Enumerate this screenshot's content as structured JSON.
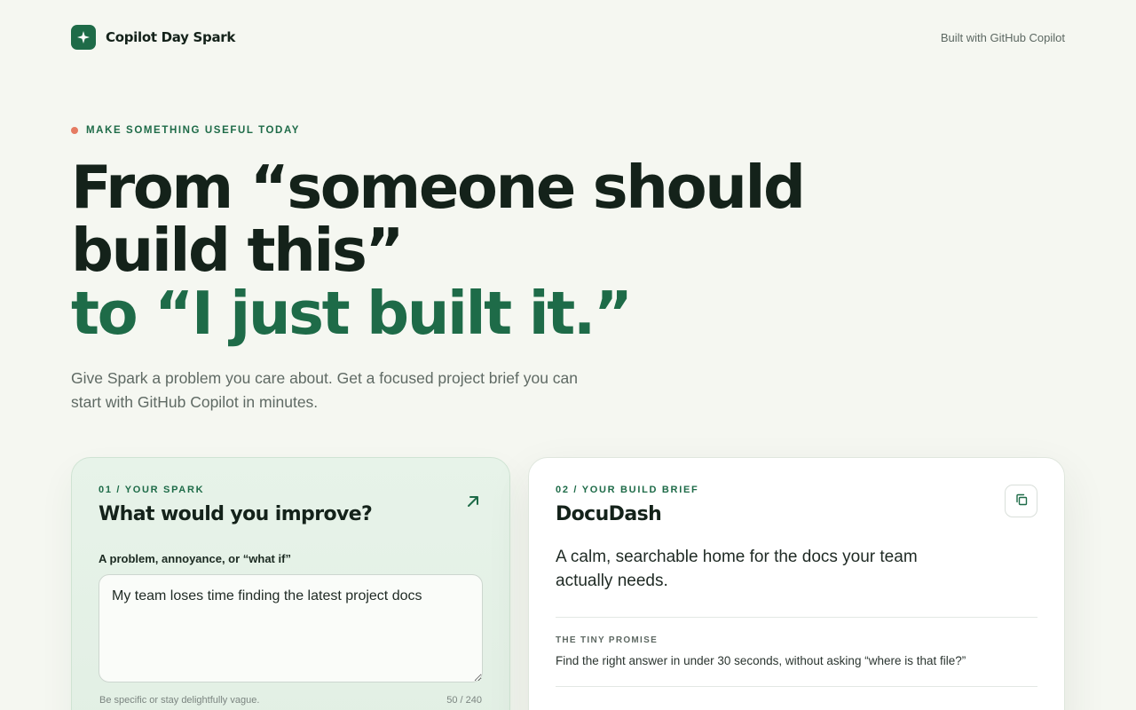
{
  "header": {
    "brand_name": "Copilot Day Spark",
    "brand_icon": "sparkle-icon",
    "built_with": "Built with GitHub Copilot"
  },
  "hero": {
    "eyebrow": "MAKE SOMETHING USEFUL TODAY",
    "headline_line1": "From “someone should",
    "headline_line2": "build this”",
    "headline_line3": "to “I just built it.”",
    "subtitle": "Give Spark a problem you care about. Get a focused project brief you can start with GitHub Copilot in minutes."
  },
  "spark_card": {
    "step": "01 / YOUR SPARK",
    "title": "What would you improve?",
    "field_label": "A problem, annoyance, or “what if”",
    "input_value": "My team loses time finding the latest project docs",
    "hint": "Be specific or stay delightfully vague.",
    "char_count": "50 / 240",
    "arrow_icon": "arrow-up-right-icon"
  },
  "brief_card": {
    "step": "02 / YOUR BUILD BRIEF",
    "title": "DocuDash",
    "tagline": "A calm, searchable home for the docs your team actually needs.",
    "promise_label": "THE TINY PROMISE",
    "promise_text": "Find the right answer in under 30 seconds, without asking “where is that file?”",
    "copy_icon": "copy-icon"
  },
  "colors": {
    "accent": "#1e6b48",
    "dot": "#e57b62",
    "background": "#f5f7f1"
  }
}
